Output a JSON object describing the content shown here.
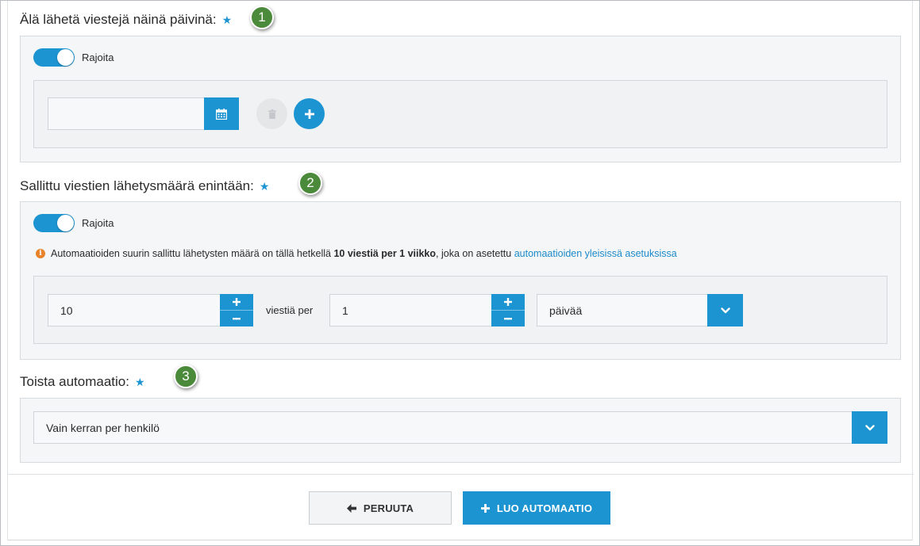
{
  "section1": {
    "title": "Älä lähetä viestejä näinä päivinä:",
    "badge": "1",
    "toggle_label": "Rajoita",
    "toggle_on": true,
    "date_input_value": "",
    "calendar_icon": "calendar-icon",
    "delete_icon": "trash-icon",
    "add_icon": "plus-icon"
  },
  "section2": {
    "title": "Sallittu viestien lähetysmäärä enintään:",
    "badge": "2",
    "toggle_label": "Rajoita",
    "toggle_on": true,
    "info_prefix": "Automaatioiden suurin sallittu lähetysten määrä on tällä hetkellä ",
    "info_bold": "10 viestiä per 1 viikko",
    "info_middle": ", joka on asetettu ",
    "info_link": "automaatioiden yleisissä asetuksissa",
    "count_value": "10",
    "per_label": "viestiä per",
    "period_value": "1",
    "unit_selected": "päivää"
  },
  "section3": {
    "title": "Toista automaatio:",
    "badge": "3",
    "repeat_selected": "Vain kerran per henkilö"
  },
  "footer": {
    "cancel_label": "PERUUTA",
    "create_label": "LUO AUTOMAATIO"
  },
  "colors": {
    "accent": "#1c94d2",
    "badge": "#4b8a3a",
    "info": "#e8822b"
  }
}
